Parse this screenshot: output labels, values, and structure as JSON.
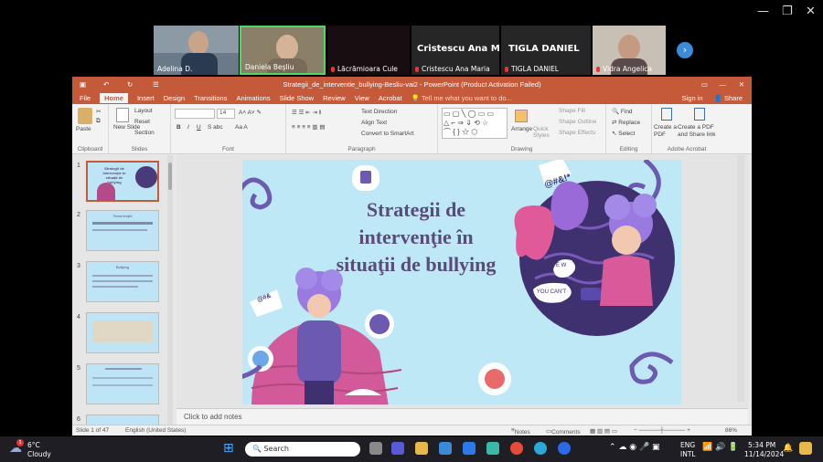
{
  "window_controls": {
    "minimize": "—",
    "maximize": "❐",
    "close": "✕"
  },
  "participants": [
    {
      "name": "Adelina D.",
      "video": true,
      "muted": false
    },
    {
      "name": "Daniela Beşliu",
      "video": true,
      "muted": false,
      "active": true
    },
    {
      "name": "Lăcrămioara Cule",
      "video": false,
      "muted": true
    },
    {
      "name": "Cristescu Ana Maria",
      "display": "Cristescu Ana M...",
      "video": false,
      "muted": true
    },
    {
      "name": "TIGLA DANIEL",
      "display": "TIGLA DANIEL",
      "video": false,
      "muted": true
    },
    {
      "name": "Vidra Angelica",
      "video": true,
      "muted": true
    }
  ],
  "ppt": {
    "title": "Strategii_de_interventie_bullying-Besliu-vai2 - PowerPoint (Product Activation Failed)",
    "tabs": [
      "File",
      "Home",
      "Insert",
      "Design",
      "Transitions",
      "Animations",
      "Slide Show",
      "Review",
      "View",
      "Acrobat"
    ],
    "active_tab": "Home",
    "tell_me": "Tell me what you want to do...",
    "sign_in": "Sign in",
    "share": "Share",
    "ribbon": {
      "clipboard": {
        "label": "Clipboard",
        "paste": "Paste"
      },
      "slides": {
        "label": "Slides",
        "new_slide": "New Slide",
        "layout": "Layout",
        "reset": "Reset",
        "section": "Section"
      },
      "font": {
        "label": "Font",
        "size": "14"
      },
      "paragraph": {
        "label": "Paragraph",
        "text_direction": "Text Direction",
        "align_text": "Align Text",
        "convert": "Convert to SmartArt"
      },
      "drawing": {
        "label": "Drawing",
        "arrange": "Arrange",
        "quick_styles": "Quick Styles",
        "shape_fill": "Shape Fill",
        "shape_outline": "Shape Outline",
        "shape_effects": "Shape Effects"
      },
      "editing": {
        "label": "Editing",
        "find": "Find",
        "replace": "Replace",
        "select": "Select"
      },
      "acrobat": {
        "label": "Adobe Acrobat",
        "create_pdf": "Create a PDF",
        "create_share": "Create a PDF and Share link"
      }
    },
    "thumbnails": [
      {
        "n": "1",
        "title": "Strategii de intervenţie în situaţii de bullying",
        "selected": true
      },
      {
        "n": "2",
        "title": "Tema lecţiei",
        "selected": false
      },
      {
        "n": "3",
        "title": "Bullying",
        "selected": false
      },
      {
        "n": "4",
        "title": "",
        "selected": false
      },
      {
        "n": "5",
        "title": "",
        "selected": false
      },
      {
        "n": "6",
        "title": "",
        "selected": false
      }
    ],
    "slide": {
      "title": "Strategii de intervenţie în situaţii de bullying",
      "bubbles": [
        "@#&!*",
        "@#&",
        "E W",
        "YOU CAN'T"
      ]
    },
    "notes_placeholder": "Click to add notes",
    "status": {
      "slide": "Slide 1 of 47",
      "language": "English (United States)",
      "notes": "Notes",
      "comments": "Comments",
      "zoom": "86%"
    }
  },
  "taskbar": {
    "weather_temp": "6°C",
    "weather_desc": "Cloudy",
    "weather_badge": "1",
    "search_placeholder": "Search",
    "lang": "ENG",
    "layout": "INTL",
    "time": "5:34 PM",
    "date": "11/14/2024"
  }
}
